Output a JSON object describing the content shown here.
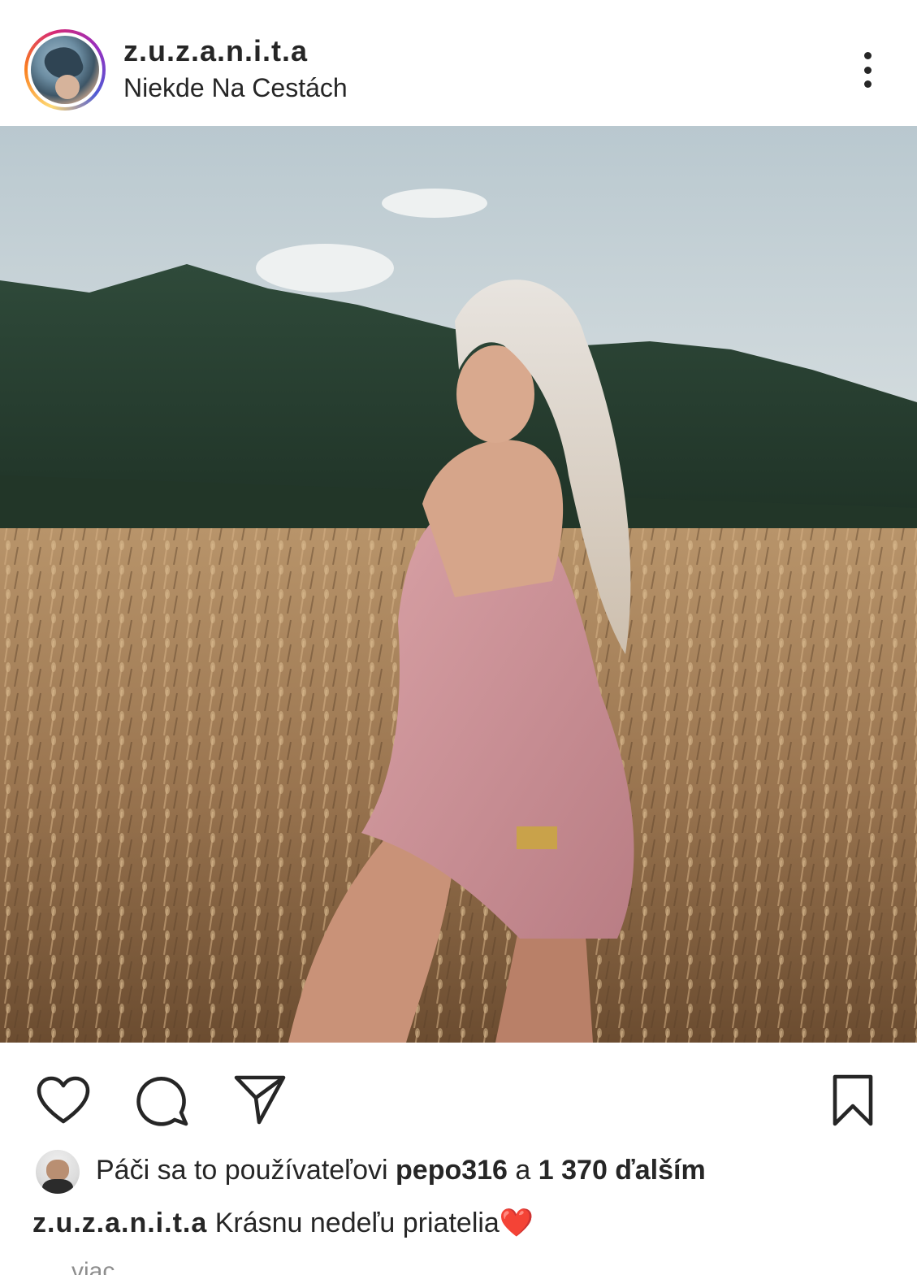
{
  "header": {
    "username": "z.u.z.a.n.i.t.a",
    "location": "Niekde Na Cestách",
    "more_icon": "more-vertical-icon"
  },
  "photo": {
    "alt_label": "post-photo"
  },
  "actions": {
    "like_icon": "heart-icon",
    "comment_icon": "comment-icon",
    "share_icon": "send-icon",
    "save_icon": "bookmark-icon"
  },
  "likes": {
    "prefix": "Páči sa to používateľovi ",
    "user": "pepo316",
    "middle": " a ",
    "count": "1 370 ďalším"
  },
  "caption": {
    "username": "z.u.z.a.n.i.t.a",
    "text": " Krásnu nedeľu priatelia",
    "emoji": "❤️"
  },
  "more_link": "viac"
}
